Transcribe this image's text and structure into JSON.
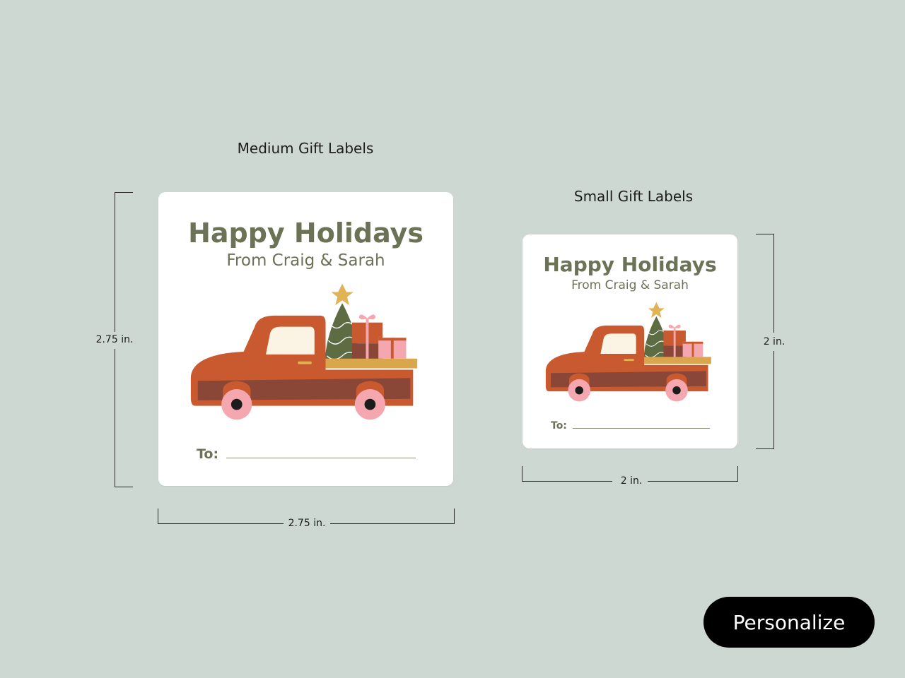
{
  "medium": {
    "caption": "Medium Gift Labels",
    "greeting": "Happy Holidays",
    "from": "From Craig & Sarah",
    "to_label": "To:",
    "height_dim": "2.75 in.",
    "width_dim": "2.75 in."
  },
  "small": {
    "caption": "Small Gift Labels",
    "greeting": "Happy Holidays",
    "from": "From Craig & Sarah",
    "to_label": "To:",
    "height_dim": "2 in.",
    "width_dim": "2 in."
  },
  "actions": {
    "personalize_label": "Personalize"
  },
  "colors": {
    "background": "#cdd8d3",
    "text_olive": "#6b7256",
    "truck": "#c95a2f",
    "truck_dark": "#8a4637",
    "tire": "#f4a7ae",
    "tree": "#5e6c44",
    "bed": "#d9a54d",
    "button": "#000000"
  },
  "icons": [
    "pickup-truck-illustration",
    "christmas-tree-icon",
    "gift-box-icon",
    "star-icon"
  ]
}
